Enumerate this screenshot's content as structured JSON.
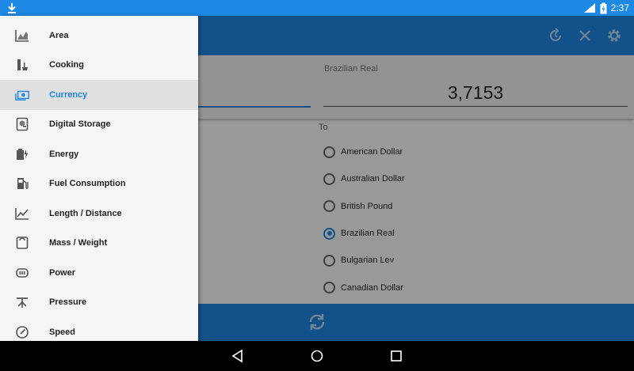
{
  "status_bar": {
    "time": "2:37",
    "icons": [
      "download-icon",
      "signal-icon",
      "battery-charging-icon"
    ]
  },
  "toolbar": {
    "actions": [
      "history-icon",
      "clear-icon",
      "settings-icon"
    ]
  },
  "converter": {
    "to_unit_label": "Brazilian Real",
    "to_value": "3,7153"
  },
  "to_list": {
    "header": "To",
    "options": [
      {
        "label": "American Dollar",
        "selected": false
      },
      {
        "label": "Australian Dollar",
        "selected": false
      },
      {
        "label": "British Pound",
        "selected": false
      },
      {
        "label": "Brazilian Real",
        "selected": true
      },
      {
        "label": "Bulgarian Lev",
        "selected": false
      },
      {
        "label": "Canadian Dollar",
        "selected": false
      }
    ]
  },
  "bottom_bar": {
    "swap_icon": "swap-icon"
  },
  "drawer": {
    "items": [
      {
        "label": "Area",
        "icon": "area-chart-icon",
        "active": false
      },
      {
        "label": "Cooking",
        "icon": "cooking-icon",
        "active": false
      },
      {
        "label": "Currency",
        "icon": "currency-icon",
        "active": true
      },
      {
        "label": "Digital Storage",
        "icon": "storage-icon",
        "active": false
      },
      {
        "label": "Energy",
        "icon": "energy-icon",
        "active": false
      },
      {
        "label": "Fuel Consumption",
        "icon": "fuel-icon",
        "active": false
      },
      {
        "label": "Length / Distance",
        "icon": "length-chart-icon",
        "active": false
      },
      {
        "label": "Mass / Weight",
        "icon": "weight-icon",
        "active": false
      },
      {
        "label": "Power",
        "icon": "power-icon",
        "active": false
      },
      {
        "label": "Pressure",
        "icon": "pressure-icon",
        "active": false
      },
      {
        "label": "Speed",
        "icon": "speedometer-icon",
        "active": false
      }
    ]
  },
  "nav_bar": {
    "buttons": [
      "back-icon",
      "home-icon",
      "recents-icon"
    ]
  },
  "colors": {
    "accent": "#1e88e5",
    "drawer_bg": "#f5f5f5",
    "active_row": "#e0e0e0"
  }
}
